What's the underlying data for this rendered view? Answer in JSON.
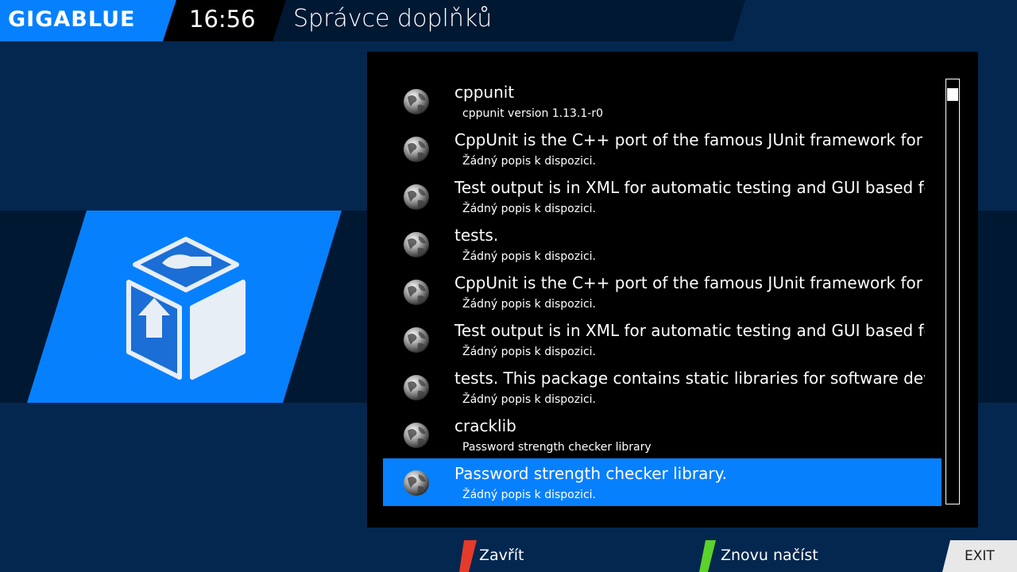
{
  "header": {
    "logo_text": "GIGABLUE",
    "clock": "16:56",
    "title": "Správce doplňků"
  },
  "colors": {
    "background": "#03274f",
    "band": "#011833",
    "accent_blue": "#0780fd",
    "red_key": "#e53b2a",
    "green_key": "#5bd32a"
  },
  "plugin_list": {
    "items": [
      {
        "title": "cppunit",
        "description": "cppunit version 1.13.1-r0",
        "icon": "globe-icon"
      },
      {
        "title": "CppUnit is the C++ port of the famous JUnit framework for unit",
        "description": "Žádný popis k dispozici.",
        "icon": "globe-icon"
      },
      {
        "title": "Test output is in XML for automatic testing and GUI based for su",
        "description": "Žádný popis k dispozici.",
        "icon": "globe-icon"
      },
      {
        "title": "tests.",
        "description": "Žádný popis k dispozici.",
        "icon": "globe-icon"
      },
      {
        "title": "CppUnit is the C++ port of the famous JUnit framework for unit",
        "description": "Žádný popis k dispozici.",
        "icon": "globe-icon"
      },
      {
        "title": "Test output is in XML for automatic testing and GUI based for su",
        "description": "Žádný popis k dispozici.",
        "icon": "globe-icon"
      },
      {
        "title": "tests.   This package contains static libraries for software develop",
        "description": "Žádný popis k dispozici.",
        "icon": "globe-icon"
      },
      {
        "title": "cracklib",
        "description": "Password strength checker library",
        "icon": "globe-icon"
      },
      {
        "title": "Password strength checker library.",
        "description": "Žádný popis k dispozici.",
        "icon": "globe-icon",
        "selected": true
      }
    ]
  },
  "footer": {
    "red_button_label": "Zavřít",
    "green_button_label": "Znovu načíst",
    "exit_label": "EXIT"
  }
}
